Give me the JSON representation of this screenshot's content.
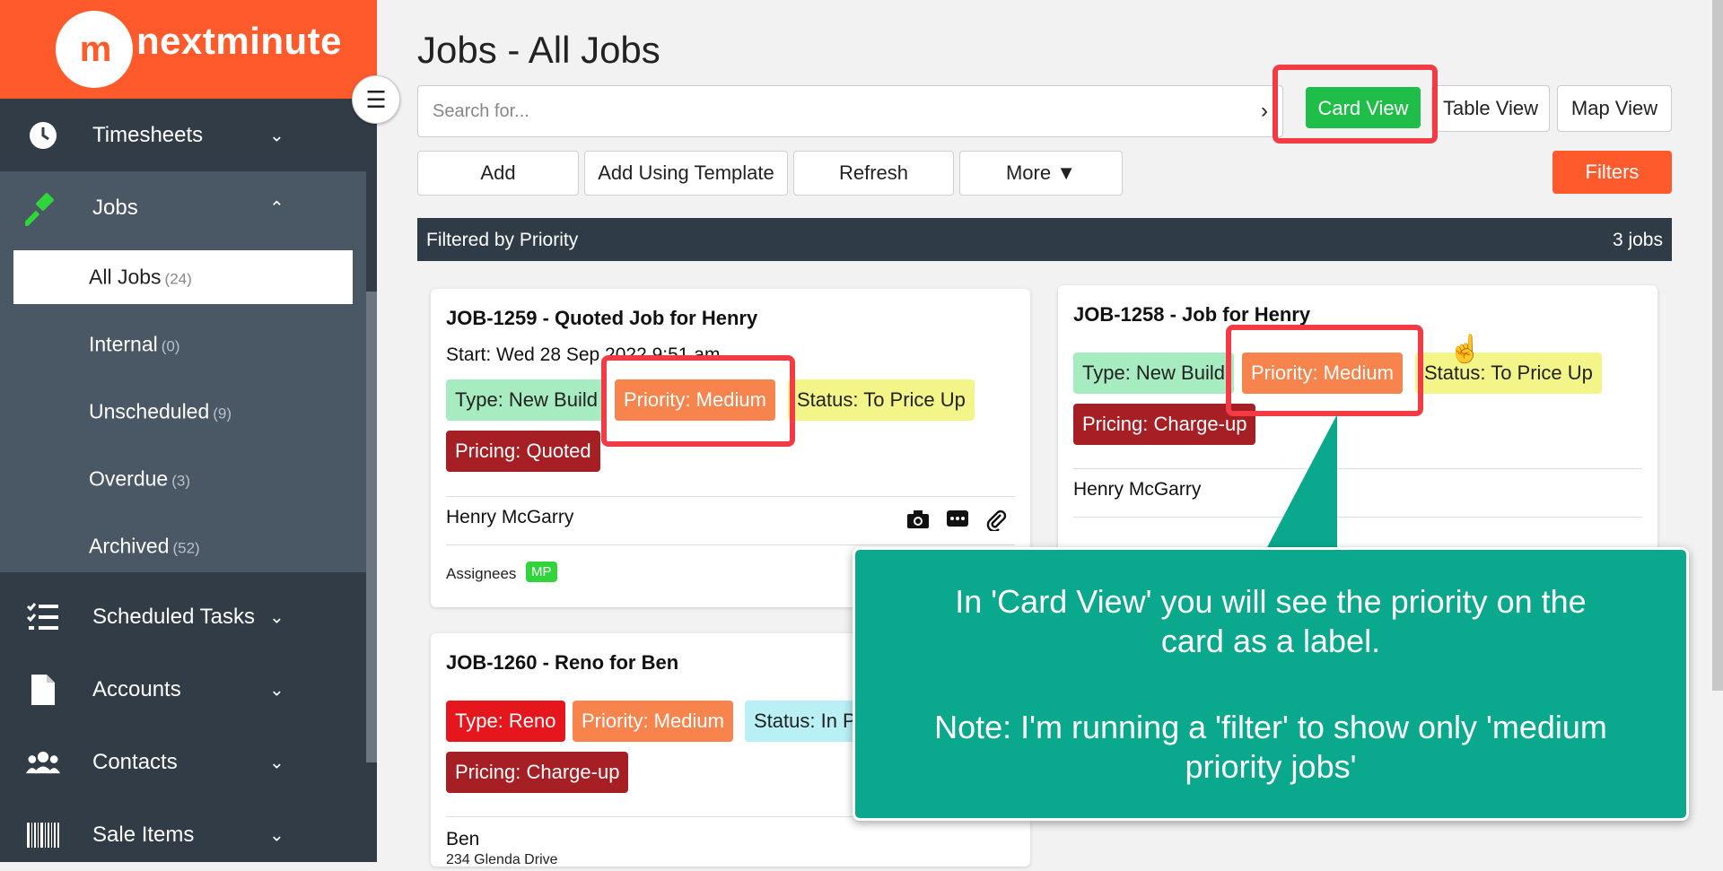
{
  "app": {
    "logo_mark": "m",
    "logo_text": "nextminute"
  },
  "sidebar": {
    "items": [
      {
        "label": "Timesheets",
        "icon": "clock-icon"
      },
      {
        "label": "Jobs",
        "icon": "gavel-icon"
      },
      {
        "label": "Scheduled Tasks",
        "icon": "checklist-icon"
      },
      {
        "label": "Accounts",
        "icon": "file-icon"
      },
      {
        "label": "Contacts",
        "icon": "users-icon"
      },
      {
        "label": "Sale Items",
        "icon": "barcode-icon"
      }
    ],
    "jobs_sub": [
      {
        "label": "All Jobs",
        "count": "(24)"
      },
      {
        "label": "Internal",
        "count": "(0)"
      },
      {
        "label": "Unscheduled",
        "count": "(9)"
      },
      {
        "label": "Overdue",
        "count": "(3)"
      },
      {
        "label": "Archived",
        "count": "(52)"
      }
    ]
  },
  "page": {
    "title": "Jobs - All Jobs"
  },
  "search": {
    "placeholder": "Search for..."
  },
  "views": {
    "card": "Card View",
    "table": "Table View",
    "map": "Map View"
  },
  "actions": {
    "add": "Add",
    "add_template": "Add Using Template",
    "refresh": "Refresh",
    "more": "More ▼",
    "filters": "Filters"
  },
  "filter_bar": {
    "label": "Filtered by Priority",
    "count": "3 jobs"
  },
  "cards": [
    {
      "title": "JOB-1259 - Quoted Job for Henry",
      "start": "Start: Wed 28 Sep 2022 9:51 am",
      "tags": [
        "Type: New Build",
        "Priority: Medium",
        "Status: To Price Up",
        "Pricing: Quoted"
      ],
      "client": "Henry McGarry",
      "assignees_label": "Assignees",
      "assignee": "MP"
    },
    {
      "title": "JOB-1258 - Job for Henry",
      "tags": [
        "Type: New Build",
        "Priority: Medium",
        "Status: To Price Up",
        "Pricing: Charge-up"
      ],
      "client": "Henry McGarry"
    },
    {
      "title": "JOB-1260 - Reno for Ben",
      "tags": [
        "Type: Reno",
        "Priority: Medium",
        "Status: In Pr",
        "Pricing: Charge-up"
      ],
      "client": "Ben",
      "address": "234 Glenda Drive"
    }
  ],
  "callout": {
    "line1": "In 'Card View' you will see the priority on the card as a label.",
    "line2": "Note: I'm running a 'filter' to show only 'medium priority jobs'"
  }
}
